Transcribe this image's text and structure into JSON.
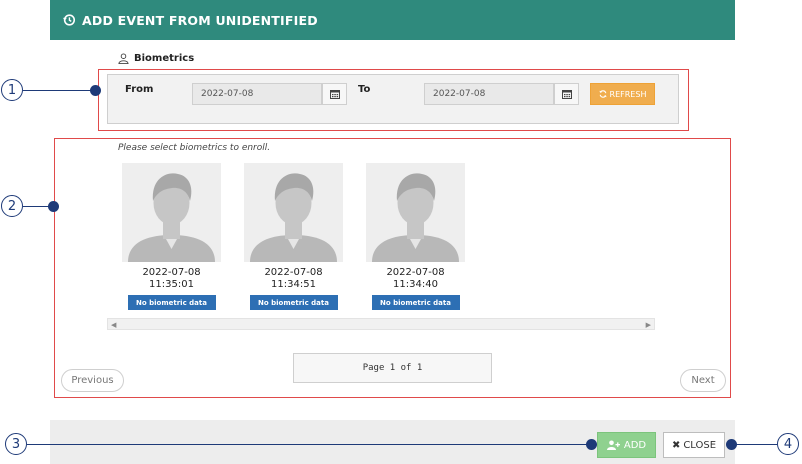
{
  "dialog": {
    "title": "ADD EVENT FROM UNIDENTIFIED",
    "header_color": "#2f8a7d"
  },
  "biometrics_label": "Biometrics",
  "filter": {
    "from_label": "From",
    "from_value": "2022-07-08",
    "to_label": "To",
    "to_value": "2022-07-08",
    "refresh_label": "REFRESH"
  },
  "hint": "Please select biometrics to enroll.",
  "cards": [
    {
      "date": "2022-07-08",
      "time": "11:35:01",
      "badge": "No biometric data"
    },
    {
      "date": "2022-07-08",
      "time": "11:34:51",
      "badge": "No biometric data"
    },
    {
      "date": "2022-07-08",
      "time": "11:34:40",
      "badge": "No biometric data"
    }
  ],
  "pager": {
    "previous": "Previous",
    "page_text": "Page 1 of 1",
    "next": "Next"
  },
  "footer": {
    "add_label": "ADD",
    "close_label": "CLOSE"
  },
  "callouts": [
    "1",
    "2",
    "3",
    "4"
  ],
  "colors": {
    "accent": "#2f8a7d",
    "refresh": "#f0ad4e",
    "badge": "#2d6fb4",
    "add": "#8fd18f",
    "annotation": "#1e3a78",
    "highlight": "#e04a4a"
  }
}
